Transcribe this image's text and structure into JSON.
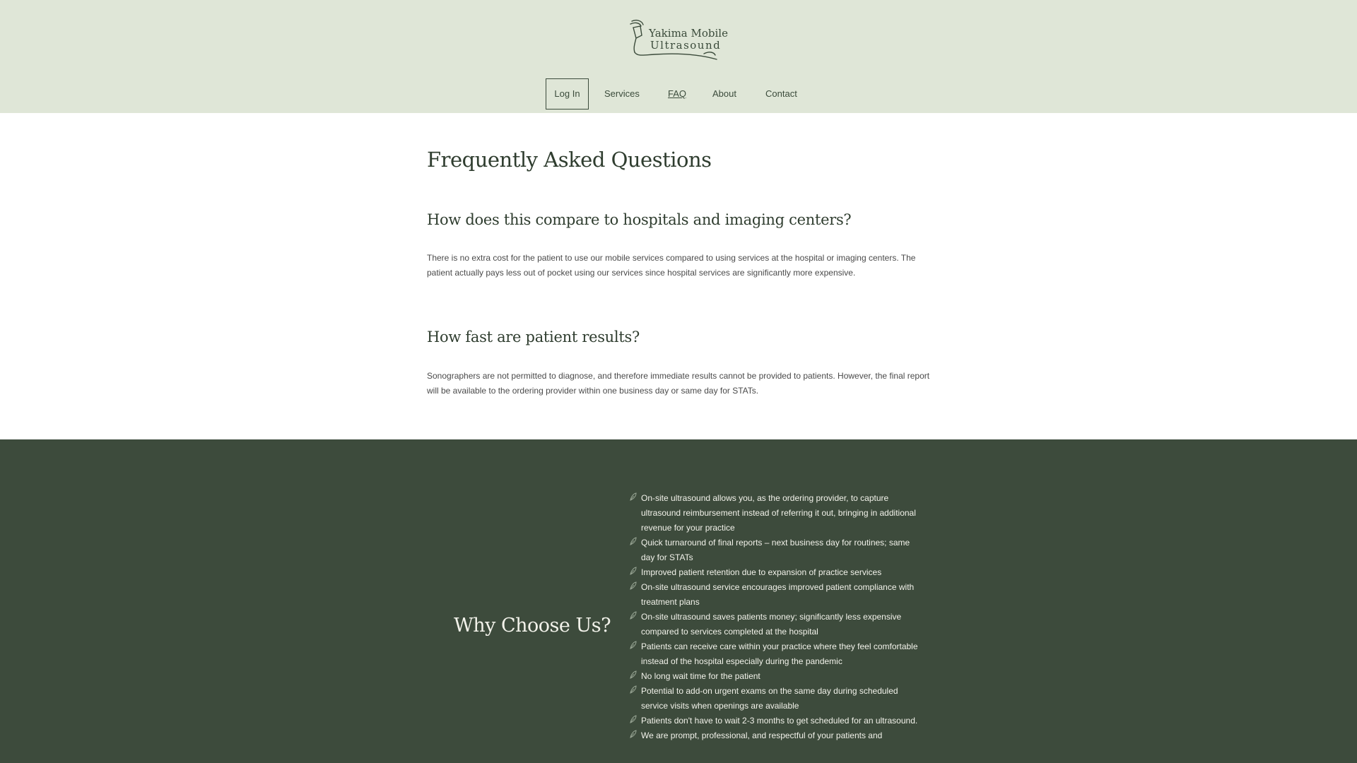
{
  "header": {
    "logo": {
      "line1": "Yakima Mobile",
      "line2": "Ultrasound",
      "icon": "ultrasound-probe-icon"
    },
    "nav": {
      "login": "Log In",
      "services": "Services",
      "faq": "FAQ",
      "about": "About",
      "contact": "Contact"
    }
  },
  "faq": {
    "title": "Frequently Asked Questions",
    "items": [
      {
        "question": "How does this compare to hospitals and imaging centers?",
        "answer": "There is no extra cost for the patient to use our mobile services compared to using services at the hospital or imaging centers. The patient actually pays less out of pocket using our services since hospital services are significantly more expensive."
      },
      {
        "question": "How fast are patient results?",
        "answer": "Sonographers are not permitted to diagnose, and therefore immediate results cannot be provided to patients. However, the final report will be available to the ordering provider within one business day or same day for STATs."
      }
    ]
  },
  "why": {
    "title": "Why Choose Us?",
    "bullet_icon": "leaf-icon",
    "benefits": [
      "On-site ultrasound allows you, as the ordering provider, to capture ultrasound reimbursement instead of referring it out, bringing in additional revenue for your practice",
      "Quick turnaround of final reports – next business day for routines; same day for STATs",
      "Improved patient retention due to expansion of practice services",
      "On-site ultrasound service encourages improved patient compliance with treatment plans",
      "On-site ultrasound saves patients money; significantly less expensive compared to services completed at the hospital",
      "Patients can receive care within your practice where they feel comfortable instead of the hospital especially during the pandemic",
      "No long wait time for the patient",
      "Potential to add-on urgent exams on the same day during scheduled service visits when openings are available",
      "Patients don't have to wait 2-3 months to get scheduled for an ultrasound.",
      "We are prompt, professional, and respectful of your patients and"
    ]
  },
  "colors": {
    "header_bg": "#dfe6d7",
    "dark_green": "#3d4b3c",
    "text_dark": "#2f3d2f"
  }
}
